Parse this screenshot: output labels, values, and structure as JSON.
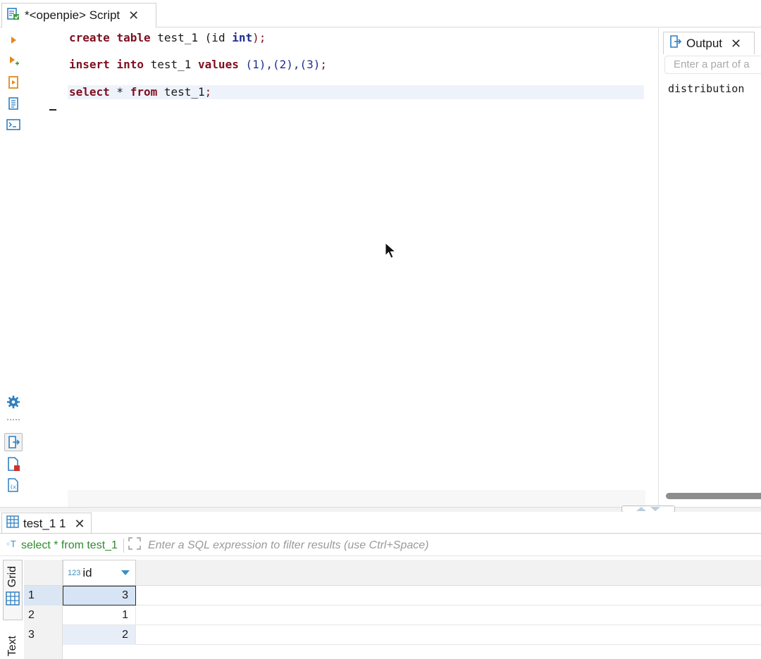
{
  "editor_tab": {
    "title": "*<openpie> Script",
    "close": "✕"
  },
  "code": {
    "line1": {
      "kw1": "create",
      "kw2": "table",
      "ident": " test_1 (id ",
      "type": "int",
      "end": ");"
    },
    "line2": {
      "kw1": "insert",
      "kw2": "into",
      "ident": " test_1 ",
      "kw3": "values",
      "vals": " (1),(2),(3)",
      "end": ";"
    },
    "line3": {
      "kw1": "select",
      "mid": " * ",
      "kw2": "from",
      "ident": " test_1",
      "end": ";"
    }
  },
  "output_panel": {
    "tab_label": "Output",
    "close": "✕",
    "filter_placeholder": "Enter a part of a",
    "text": "distribution"
  },
  "results": {
    "tab_label": "test_1 1",
    "close": "✕",
    "query_label": "select * from test_1",
    "filter_placeholder": "Enter a SQL expression to filter results (use Ctrl+Space)",
    "side_tabs": {
      "grid": "Grid",
      "text": "Text"
    },
    "columns": [
      {
        "type": "123",
        "name": "id"
      }
    ],
    "rows": [
      {
        "num": "1",
        "id": "3"
      },
      {
        "num": "2",
        "id": "1"
      },
      {
        "num": "3",
        "id": "2"
      }
    ]
  },
  "colors": {
    "keyword": "#7f0f1f",
    "type_keyword": "#1f2f8f",
    "query_label": "#2e8b2e",
    "accent": "#3a8fbf"
  }
}
